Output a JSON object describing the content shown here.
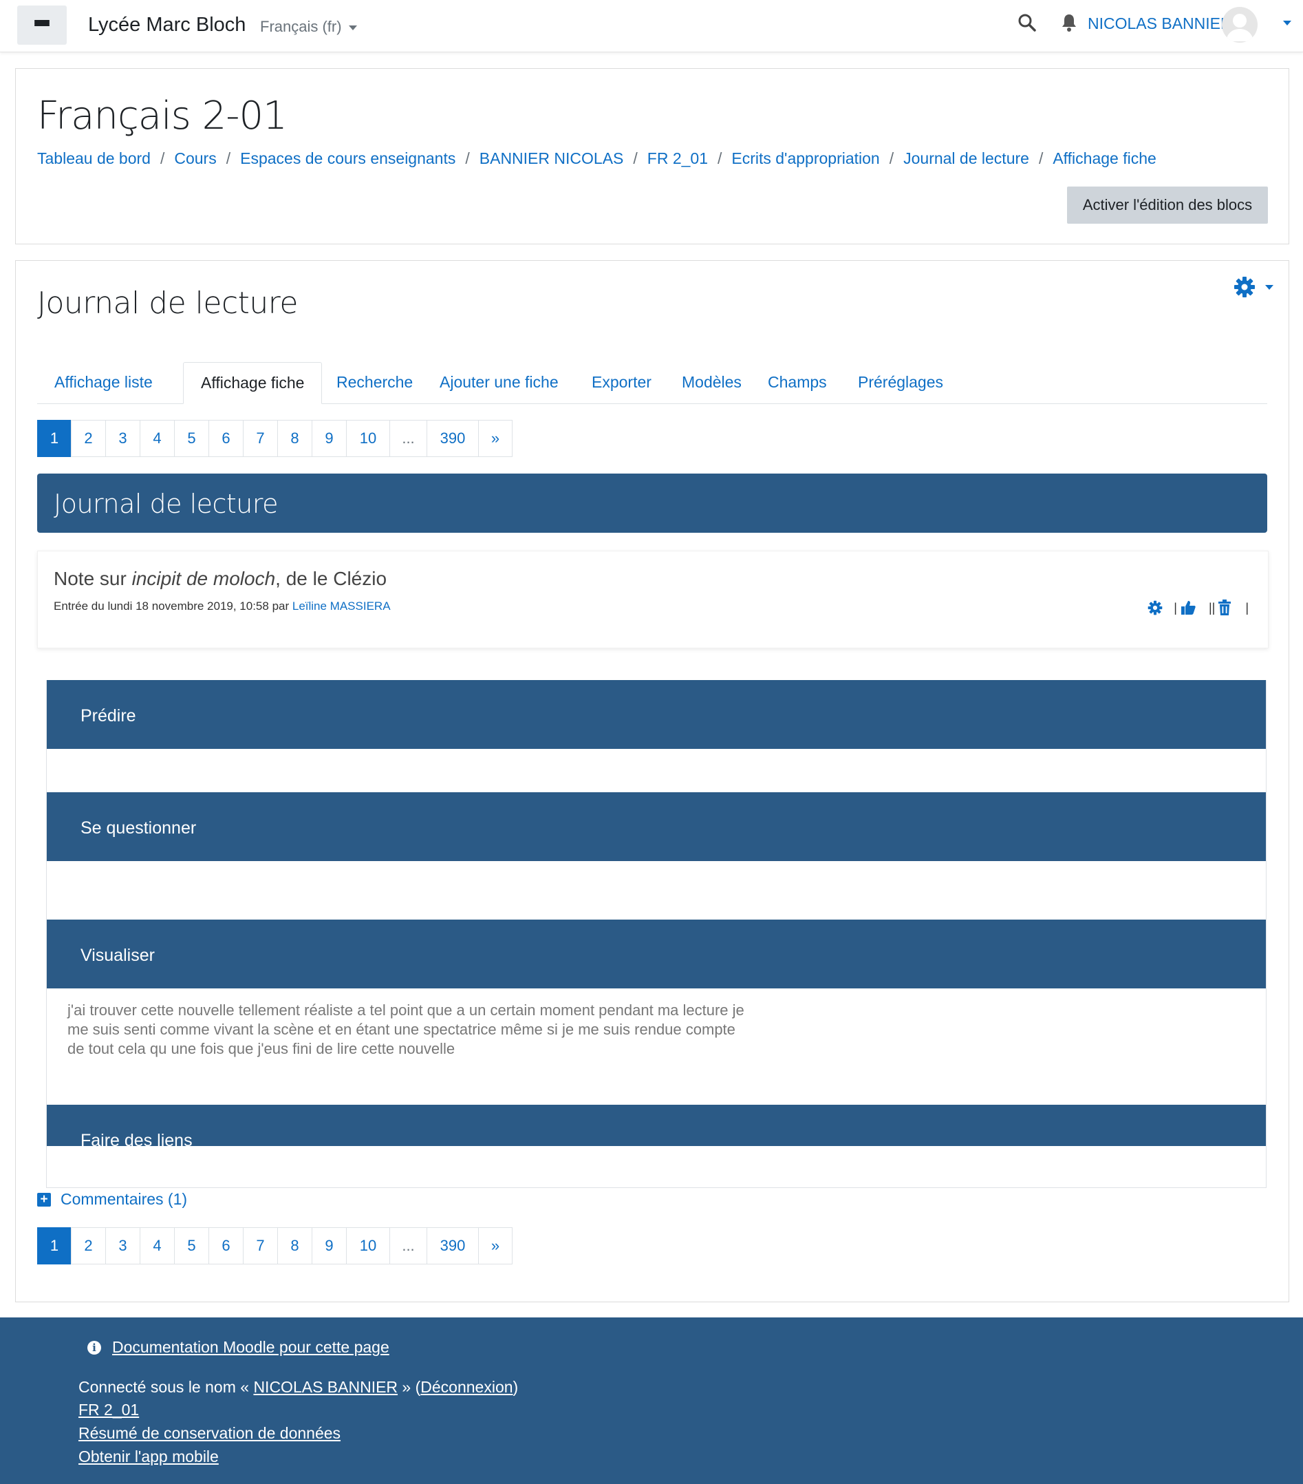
{
  "navbar": {
    "site_name": "Lycée Marc Bloch",
    "language": "Français (fr)",
    "user_name": "NICOLAS BANNIER"
  },
  "header": {
    "course_title": "Français 2-01",
    "breadcrumb": [
      "Tableau de bord",
      "Cours",
      "Espaces de cours enseignants",
      "BANNIER NICOLAS",
      "FR 2_01",
      "Ecrits d'appropriation",
      "Journal de lecture",
      "Affichage fiche"
    ],
    "edit_blocks_button": "Activer l'édition des blocs"
  },
  "activity": {
    "title": "Journal de lecture",
    "tabs": [
      "Affichage liste",
      "Affichage fiche",
      "Recherche",
      "Ajouter une fiche",
      "Exporter",
      "Modèles",
      "Champs",
      "Préréglages"
    ],
    "active_tab": "Affichage fiche",
    "pagination": [
      "1",
      "2",
      "3",
      "4",
      "5",
      "6",
      "7",
      "8",
      "9",
      "10",
      "...",
      "390",
      "»"
    ],
    "current_page": "1"
  },
  "entry": {
    "banner": "Journal de lecture",
    "title_prefix": "Note sur ",
    "title_work": "incipit de moloch",
    "title_suffix": ", de le Clézio",
    "meta_prefix": "Entrée du lundi 18 novembre 2019, 10:58 par ",
    "author": "Leïline MASSIERA",
    "sections": [
      {
        "heading": "Prédire",
        "body": ""
      },
      {
        "heading": "Se questionner",
        "body": ""
      },
      {
        "heading": "Visualiser",
        "body": "j'ai trouver cette nouvelle tellement réaliste a tel point que a un certain moment pendant ma lecture je me suis senti comme vivant la scène et en étant une spectatrice même si je me suis rendue compte de tout cela qu une fois que j'eus fini de lire cette nouvelle"
      },
      {
        "heading": "Faire des liens",
        "body": ""
      }
    ],
    "comments": "Commentaires (1)"
  },
  "footer": {
    "doc_link": "Documentation Moodle pour cette page",
    "logged_prefix": "Connecté sous le nom « ",
    "logged_user": "NICOLAS BANNIER",
    "logged_mid": " » (",
    "logout": "Déconnexion",
    "logged_suffix": ")",
    "course_link": "FR 2_01",
    "data_retention": "Résumé de conservation de données",
    "mobile_app": "Obtenir l'app mobile"
  },
  "colors": {
    "brand_blue": "#0f6fc5",
    "section_header": "#2b5a86",
    "footer_bg": "#2b5a86"
  }
}
